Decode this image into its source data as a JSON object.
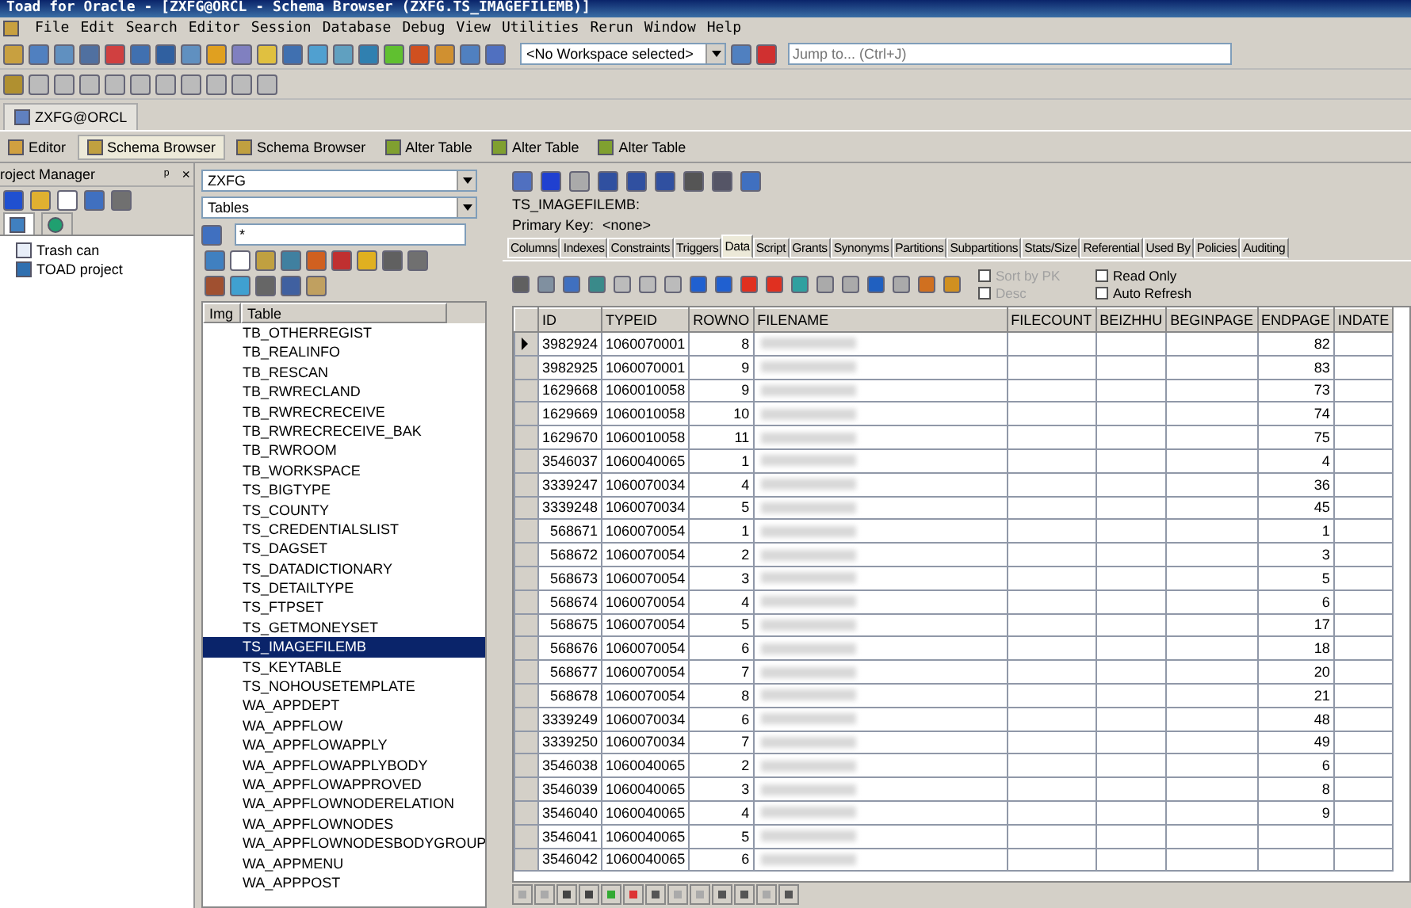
{
  "window": {
    "title": "Toad for Oracle - [ZXFG@ORCL - Schema Browser (ZXFG.TS_IMAGEFILEMB)]"
  },
  "menu": [
    "File",
    "Edit",
    "Search",
    "Editor",
    "Session",
    "Database",
    "Debug",
    "View",
    "Utilities",
    "Rerun",
    "Window",
    "Help"
  ],
  "toolbar": {
    "workspace": "<No Workspace selected>",
    "jump_placeholder": "Jump to... (Ctrl+J)"
  },
  "connection_tab": "ZXFG@ORCL",
  "doc_tabs": [
    {
      "label": "Editor",
      "selected": false
    },
    {
      "label": "Schema Browser",
      "selected": true
    },
    {
      "label": "Schema Browser",
      "selected": false
    },
    {
      "label": "Alter Table",
      "selected": false
    },
    {
      "label": "Alter Table",
      "selected": false
    },
    {
      "label": "Alter Table",
      "selected": false
    }
  ],
  "project_manager": {
    "title": "roject Manager",
    "pin": "ᵖ",
    "close": "×",
    "items": [
      {
        "label": "Trash can"
      },
      {
        "label": "TOAD project"
      }
    ]
  },
  "schema": {
    "owner": "ZXFG",
    "object_type": "Tables",
    "filter": "*",
    "columns": [
      "Img",
      "Table"
    ],
    "tables": [
      {
        "name": "TB_OTHERREGIST",
        "selected": false
      },
      {
        "name": "TB_REALINFO",
        "selected": false
      },
      {
        "name": "TB_RESCAN",
        "selected": false
      },
      {
        "name": "TB_RWRECLAND",
        "selected": false
      },
      {
        "name": "TB_RWRECRECEIVE",
        "selected": false
      },
      {
        "name": "TB_RWRECRECEIVE_BAK",
        "selected": false
      },
      {
        "name": "TB_RWROOM",
        "selected": false
      },
      {
        "name": "TB_WORKSPACE",
        "selected": false
      },
      {
        "name": "TS_BIGTYPE",
        "selected": false
      },
      {
        "name": "TS_COUNTY",
        "selected": false
      },
      {
        "name": "TS_CREDENTIALSLIST",
        "selected": false
      },
      {
        "name": "TS_DAGSET",
        "selected": false
      },
      {
        "name": "TS_DATADICTIONARY",
        "selected": false
      },
      {
        "name": "TS_DETAILTYPE",
        "selected": false
      },
      {
        "name": "TS_FTPSET",
        "selected": false
      },
      {
        "name": "TS_GETMONEYSET",
        "selected": false
      },
      {
        "name": "TS_IMAGEFILEMB",
        "selected": true
      },
      {
        "name": "TS_KEYTABLE",
        "selected": false
      },
      {
        "name": "TS_NOHOUSETEMPLATE",
        "selected": false
      },
      {
        "name": "WA_APPDEPT",
        "selected": false
      },
      {
        "name": "WA_APPFLOW",
        "selected": false
      },
      {
        "name": "WA_APPFLOWAPPLY",
        "selected": false
      },
      {
        "name": "WA_APPFLOWAPPLYBODY",
        "selected": false
      },
      {
        "name": "WA_APPFLOWAPPROVED",
        "selected": false
      },
      {
        "name": "WA_APPFLOWNODERELATION",
        "selected": false
      },
      {
        "name": "WA_APPFLOWNODES",
        "selected": false
      },
      {
        "name": "WA_APPFLOWNODESBODYGROUP",
        "selected": false
      },
      {
        "name": "WA_APPMENU",
        "selected": false
      },
      {
        "name": "WA_APPPOST",
        "selected": false
      }
    ]
  },
  "detail": {
    "object": "TS_IMAGEFILEMB:",
    "primary_key_label": "Primary Key:",
    "primary_key": "<none>",
    "tabs": [
      {
        "label": "Columns",
        "selected": false
      },
      {
        "label": "Indexes",
        "selected": false
      },
      {
        "label": "Constraints",
        "selected": false
      },
      {
        "label": "Triggers",
        "selected": false
      },
      {
        "label": "Data",
        "selected": true
      },
      {
        "label": "Script",
        "selected": false
      },
      {
        "label": "Grants",
        "selected": false
      },
      {
        "label": "Synonyms",
        "selected": false
      },
      {
        "label": "Partitions",
        "selected": false
      },
      {
        "label": "Subpartitions",
        "selected": false
      },
      {
        "label": "Stats/Size",
        "selected": false
      },
      {
        "label": "Referential",
        "selected": false
      },
      {
        "label": "Used By",
        "selected": false
      },
      {
        "label": "Policies",
        "selected": false
      },
      {
        "label": "Auditing",
        "selected": false
      }
    ],
    "options": [
      {
        "label": "Sort by PK",
        "checked": false,
        "disabled": true
      },
      {
        "label": "Desc",
        "checked": false,
        "disabled": true
      },
      {
        "label": "Read Only",
        "checked": false,
        "disabled": false
      },
      {
        "label": "Auto Refresh",
        "checked": false,
        "disabled": false
      }
    ]
  },
  "table": {
    "columns": [
      "ID",
      "TYPEID",
      "ROWNO",
      "FILENAME",
      "FILECOUNT",
      "BEIZHHU",
      "BEGINPAGE",
      "ENDPAGE",
      "INDATE"
    ],
    "rows": [
      {
        "id": "3982924",
        "typeid": "1060070001",
        "rowno": "8",
        "endpage": "82",
        "current": true
      },
      {
        "id": "3982925",
        "typeid": "1060070001",
        "rowno": "9",
        "endpage": "83",
        "current": false
      },
      {
        "id": "1629668",
        "typeid": "1060010058",
        "rowno": "9",
        "endpage": "73",
        "current": false
      },
      {
        "id": "1629669",
        "typeid": "1060010058",
        "rowno": "10",
        "endpage": "74",
        "current": false
      },
      {
        "id": "1629670",
        "typeid": "1060010058",
        "rowno": "11",
        "endpage": "75",
        "current": false
      },
      {
        "id": "3546037",
        "typeid": "1060040065",
        "rowno": "1",
        "endpage": "4",
        "current": false
      },
      {
        "id": "3339247",
        "typeid": "1060070034",
        "rowno": "4",
        "endpage": "36",
        "current": false
      },
      {
        "id": "3339248",
        "typeid": "1060070034",
        "rowno": "5",
        "endpage": "45",
        "current": false
      },
      {
        "id": "568671",
        "typeid": "1060070054",
        "rowno": "1",
        "endpage": "1",
        "current": false
      },
      {
        "id": "568672",
        "typeid": "1060070054",
        "rowno": "2",
        "endpage": "3",
        "current": false
      },
      {
        "id": "568673",
        "typeid": "1060070054",
        "rowno": "3",
        "endpage": "5",
        "current": false
      },
      {
        "id": "568674",
        "typeid": "1060070054",
        "rowno": "4",
        "endpage": "6",
        "current": false
      },
      {
        "id": "568675",
        "typeid": "1060070054",
        "rowno": "5",
        "endpage": "17",
        "current": false
      },
      {
        "id": "568676",
        "typeid": "1060070054",
        "rowno": "6",
        "endpage": "18",
        "current": false
      },
      {
        "id": "568677",
        "typeid": "1060070054",
        "rowno": "7",
        "endpage": "20",
        "current": false
      },
      {
        "id": "568678",
        "typeid": "1060070054",
        "rowno": "8",
        "endpage": "21",
        "current": false
      },
      {
        "id": "3339249",
        "typeid": "1060070034",
        "rowno": "6",
        "endpage": "48",
        "current": false
      },
      {
        "id": "3339250",
        "typeid": "1060070034",
        "rowno": "7",
        "endpage": "49",
        "current": false
      },
      {
        "id": "3546038",
        "typeid": "1060040065",
        "rowno": "2",
        "endpage": "6",
        "current": false
      },
      {
        "id": "3546039",
        "typeid": "1060040065",
        "rowno": "3",
        "endpage": "8",
        "current": false
      },
      {
        "id": "3546040",
        "typeid": "1060040065",
        "rowno": "4",
        "endpage": "9",
        "current": false
      },
      {
        "id": "3546041",
        "typeid": "1060040065",
        "rowno": "5",
        "current": false
      },
      {
        "id": "3546042",
        "typeid": "1060040065",
        "rowno": "6",
        "current": false
      }
    ]
  }
}
